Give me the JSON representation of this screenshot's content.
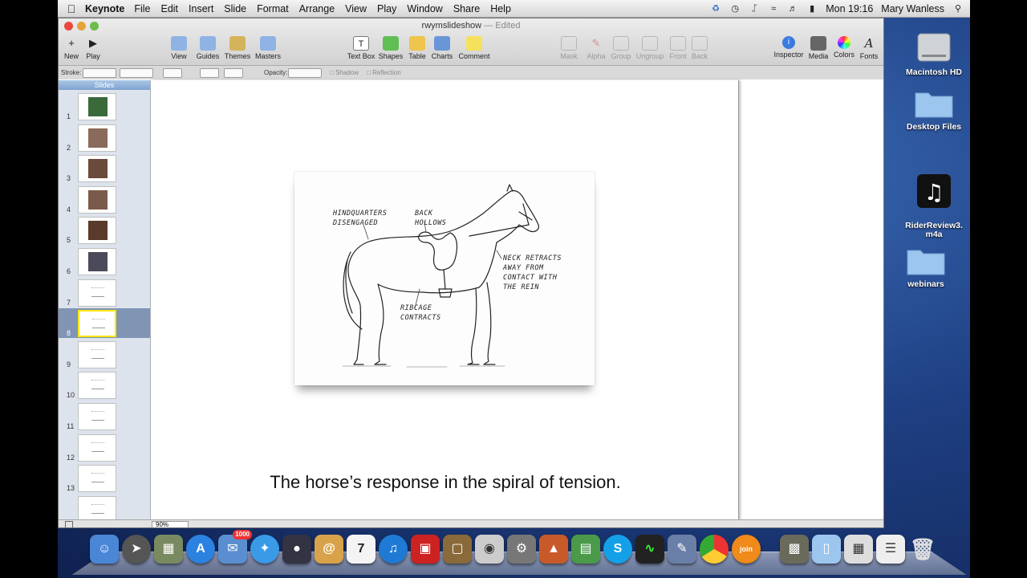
{
  "menubar": {
    "app_name": "Keynote",
    "menus": [
      "File",
      "Edit",
      "Insert",
      "Slide",
      "Format",
      "Arrange",
      "View",
      "Play",
      "Window",
      "Share",
      "Help"
    ],
    "clock": "Mon 19:16",
    "user": "Mary Wanless"
  },
  "window": {
    "title": "rwymslideshow",
    "edited_suffix": "— Edited",
    "toolbar": {
      "new": "New",
      "play": "Play",
      "view": "View",
      "guides": "Guides",
      "themes": "Themes",
      "masters": "Masters",
      "text_box": "Text Box",
      "shapes": "Shapes",
      "table": "Table",
      "charts": "Charts",
      "comment": "Comment",
      "mask": "Mask",
      "alpha": "Alpha",
      "group": "Group",
      "ungroup": "Ungroup",
      "front": "Front",
      "back": "Back",
      "inspector": "Inspector",
      "media": "Media",
      "colors": "Colors",
      "fonts": "Fonts"
    },
    "format_bar": {
      "stroke": "Stroke:",
      "opacity": "Opacity:",
      "shadow": "Shadow",
      "reflection": "Reflection"
    },
    "navigator": {
      "header": "Slides",
      "selected_index": 7,
      "slides": [
        {
          "num": "1",
          "kind": "photo"
        },
        {
          "num": "2",
          "kind": "photo"
        },
        {
          "num": "3",
          "kind": "photo"
        },
        {
          "num": "4",
          "kind": "photo"
        },
        {
          "num": "5",
          "kind": "photo"
        },
        {
          "num": "6",
          "kind": "photo"
        },
        {
          "num": "7",
          "kind": "sketch"
        },
        {
          "num": "8",
          "kind": "sketch"
        },
        {
          "num": "9",
          "kind": "sketch"
        },
        {
          "num": "10",
          "kind": "sketch"
        },
        {
          "num": "11",
          "kind": "sketch"
        },
        {
          "num": "12",
          "kind": "sketch"
        },
        {
          "num": "13",
          "kind": "sketch"
        },
        {
          "num": "",
          "kind": "sketch"
        }
      ]
    },
    "slide": {
      "caption": "The horse’s response in the spiral of tension.",
      "annotations": {
        "hindquarters": "HINDQUARTERS\nDISENGAGED",
        "back": "BACK\nHOLLOWS",
        "neck": "NECK RETRACTS\nAWAY FROM\nCONTACT WITH\nTHE REIN",
        "ribcage": "RIBCAGE\nCONTRACTS"
      }
    },
    "zoom": "90%"
  },
  "desktop": {
    "items": [
      "Macintosh HD",
      "Desktop Files",
      "RiderReview3.\nm4a",
      "webinars"
    ]
  },
  "dock": {
    "calendar_day": "7",
    "mail_badge": "1000"
  }
}
